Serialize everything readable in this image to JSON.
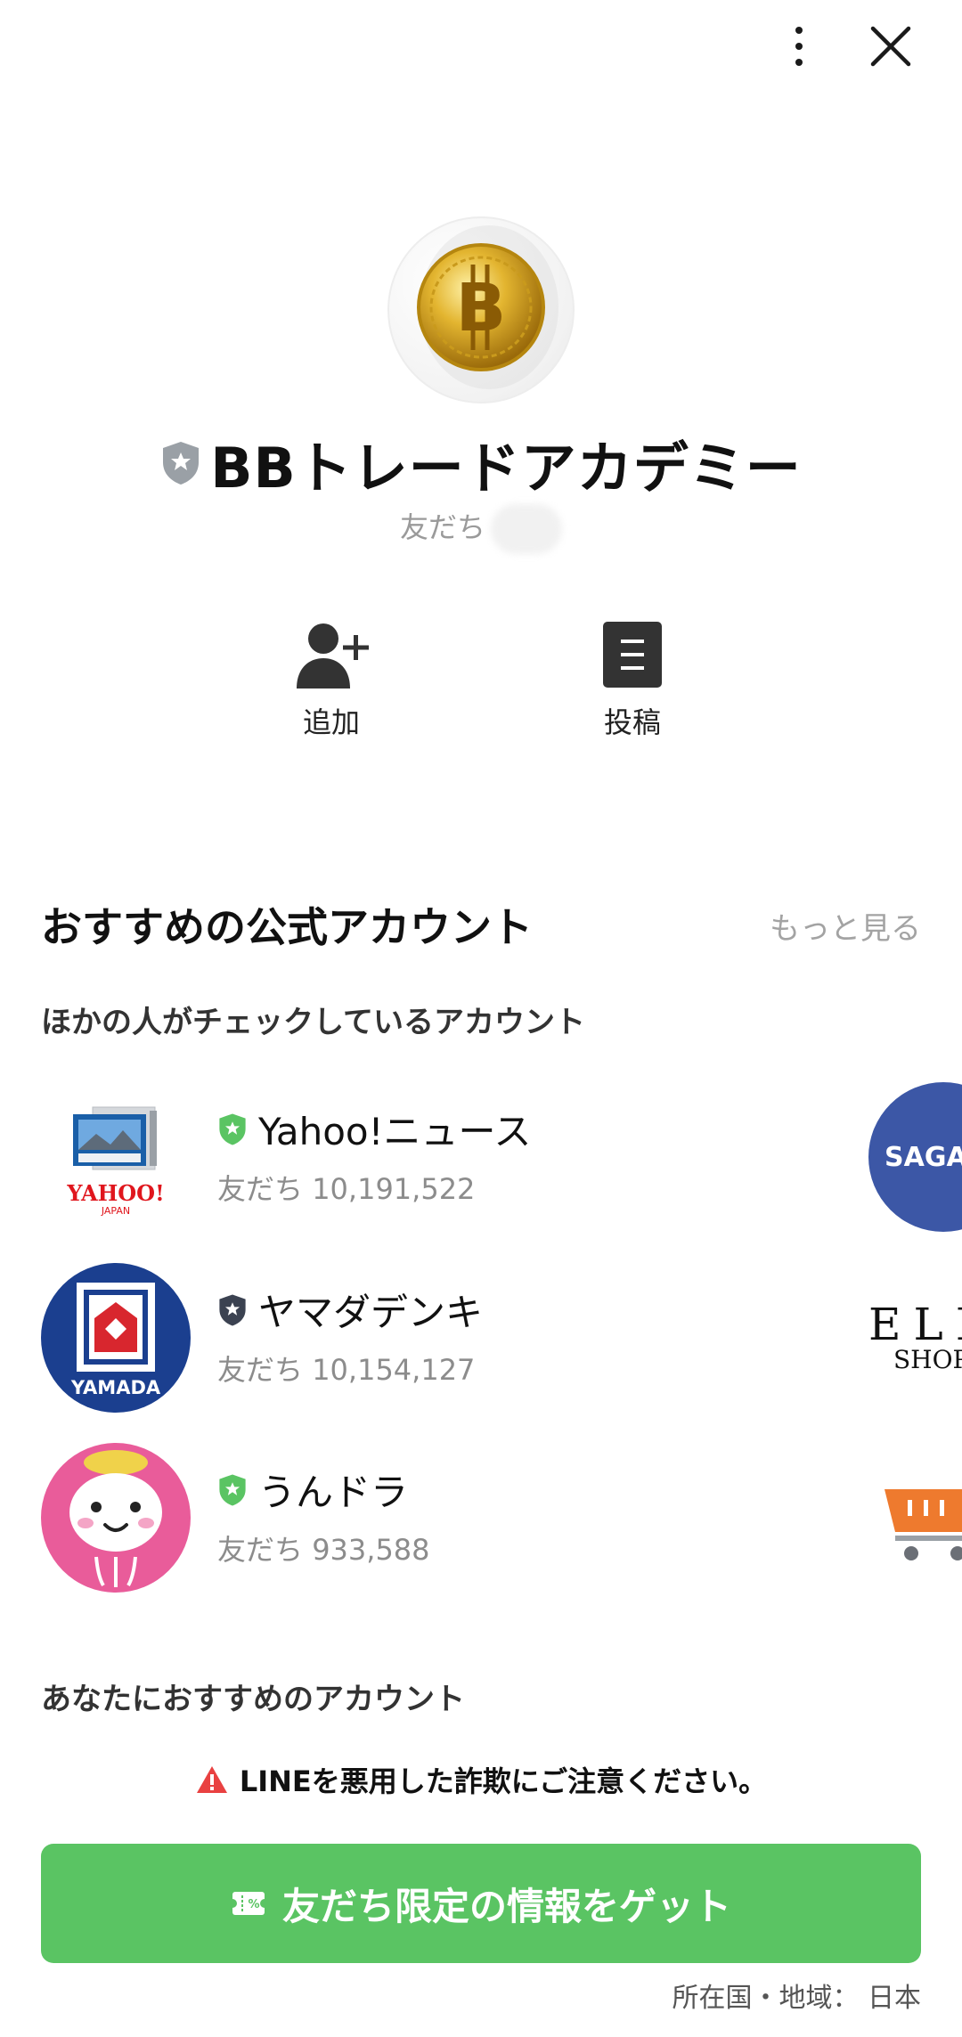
{
  "header": {
    "menu_icon": "more-vertical-icon",
    "close_icon": "close-icon"
  },
  "profile": {
    "name": "BBトレードアカデミー",
    "friends_label": "友だち",
    "badge_color": "#9aa0a6"
  },
  "actions": [
    {
      "label": "追加",
      "icon": "add-friend-icon"
    },
    {
      "label": "投稿",
      "icon": "posts-icon"
    }
  ],
  "recommended": {
    "title": "おすすめの公式アカウント",
    "more_label": "もっと見る",
    "subtitle": "ほかの人がチェックしているアカウント",
    "accounts": [
      {
        "name": "Yahoo!ニュース",
        "friends_label": "友だち",
        "count": "10,191,522",
        "badge_color": "#5ac463"
      },
      {
        "name": "ヤマダデンキ",
        "friends_label": "友だち",
        "count": "10,154,127",
        "badge_color": "#3b4251"
      },
      {
        "name": "うんドラ",
        "friends_label": "友だち",
        "count": "933,588",
        "badge_color": "#5ac463"
      }
    ],
    "side_peeks": [
      "SAGAV",
      "ELL",
      "SHOP"
    ],
    "subtitle2": "あなたにおすすめのアカウント"
  },
  "yahoo_logo_text": "YAHOO!",
  "yahoo_logo_sub": "JAPAN",
  "yamada_logo_text": "YAMADA",
  "warning": {
    "text": "LINEを悪用した詐欺にご注意ください。",
    "icon": "warning-icon",
    "color": "#e94141"
  },
  "cta": {
    "label": "友だち限定の情報をゲット",
    "icon": "coupon-icon",
    "color": "#5ac463"
  },
  "country": {
    "label": "所在国・地域：",
    "value": "日本"
  }
}
